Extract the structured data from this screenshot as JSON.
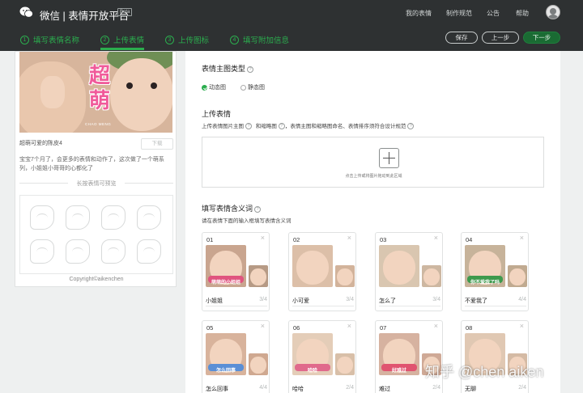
{
  "header": {
    "brand": "微信 | 表情开放平台",
    "beta": "Beta",
    "nav": [
      "我的表情",
      "制作规范",
      "公告",
      "帮助"
    ],
    "steps": [
      {
        "num": "1",
        "label": "填写表情名称"
      },
      {
        "num": "2",
        "label": "上传表情"
      },
      {
        "num": "3",
        "label": "上传图标"
      },
      {
        "num": "4",
        "label": "填写附加信息"
      }
    ],
    "save_label": "保存",
    "prev_label": "上一步",
    "next_label": "下一步"
  },
  "preview": {
    "cover_text": "超萌",
    "cover_brand": "CHAO MENG",
    "name": "超萌可爱的陈皮4",
    "download_label": "下载",
    "description": "宝宝7个月了，会更多的表情和动作了，这次做了一个萌系列，小姐姐小哥哥的心都化了",
    "long_press_title": "长按表情可预览",
    "copyright": "Copyright©aikenchen"
  },
  "form": {
    "type_title": "表情主图类型",
    "type_options": [
      "动态图",
      "静态图"
    ],
    "type_selected": "动态图",
    "upload_title": "上传表情",
    "upload_sub_1": "上传表情图片主图",
    "upload_sub_2": "和缩略图",
    "upload_sub_3": "，表情主图和缩略图命名、表情排序须符合设计规范",
    "upload_hint": "点击上传或将图片拖动到此区域",
    "meaning_title": "填写表情含义词",
    "meaning_sub": "请在表情下面的输入框填写表情含义词",
    "help_glyph": "?",
    "close_glyph": "×",
    "plus_glyph": "+"
  },
  "stickers": [
    {
      "idx": "01",
      "label": "小姐姐",
      "count": "3/4",
      "caption": "萌萌的小姐姐"
    },
    {
      "idx": "02",
      "label": "小可爱",
      "count": "3/4",
      "caption": ""
    },
    {
      "idx": "03",
      "label": "怎么了",
      "count": "3/4",
      "caption": ""
    },
    {
      "idx": "04",
      "label": "不爱我了",
      "count": "4/4",
      "caption": "你不爱我了吗"
    },
    {
      "idx": "05",
      "label": "怎么回事",
      "count": "4/4",
      "caption": "怎么回事"
    },
    {
      "idx": "06",
      "label": "哈哈",
      "count": "2/4",
      "caption": "哈哈"
    },
    {
      "idx": "07",
      "label": "难过",
      "count": "2/4",
      "caption": "好难过"
    },
    {
      "idx": "08",
      "label": "无聊",
      "count": "2/4",
      "caption": ""
    }
  ],
  "watermark": "知乎 @chen aiken",
  "colors": {
    "accent": "#2bad4e",
    "header_bg": "#2e3132",
    "page_bg": "#eef0f0"
  }
}
